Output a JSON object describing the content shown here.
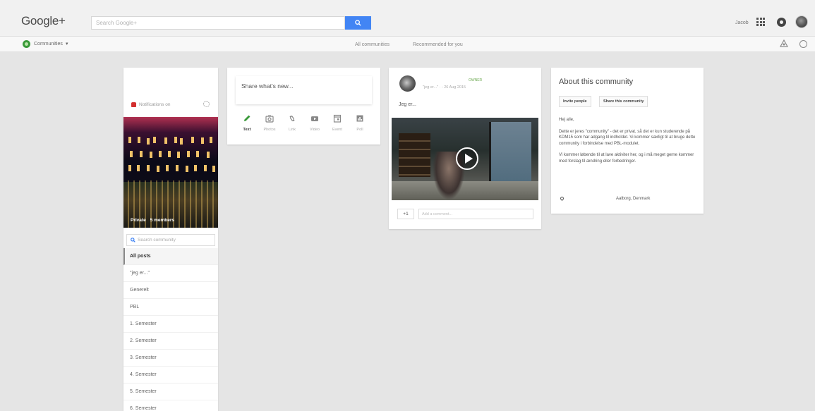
{
  "header": {
    "logo": "Google+",
    "search_placeholder": "Search Google+",
    "user_name": "Jacob"
  },
  "subnav": {
    "communities_label": "Communities",
    "all_communities": "All communities",
    "recommended": "Recommended for you"
  },
  "community": {
    "notifications": "Notifications on",
    "privacy": "Private",
    "members": "5 members",
    "search_placeholder": "Search community",
    "categories": [
      {
        "label": "All posts"
      },
      {
        "label": "\"jeg er...\""
      },
      {
        "label": "Generelt"
      },
      {
        "label": "PBL"
      },
      {
        "label": "1. Semester"
      },
      {
        "label": "2. Semester"
      },
      {
        "label": "3. Semester"
      },
      {
        "label": "4. Semester"
      },
      {
        "label": "5. Semester"
      },
      {
        "label": "6. Semester"
      }
    ]
  },
  "share": {
    "prompt": "Share what's new...",
    "options": [
      {
        "label": "Text",
        "icon": "pencil-icon"
      },
      {
        "label": "Photos",
        "icon": "camera-icon"
      },
      {
        "label": "Link",
        "icon": "link-icon"
      },
      {
        "label": "Video",
        "icon": "video-icon"
      },
      {
        "label": "Event",
        "icon": "event-icon"
      },
      {
        "label": "Poll",
        "icon": "poll-icon"
      }
    ]
  },
  "post": {
    "badge": "OWNER",
    "meta": "\"jeg er...\" · - 26 Aug 2015",
    "text": "Jeg er...",
    "plus_one": "+1",
    "comment_placeholder": "Add a comment..."
  },
  "about": {
    "title": "About this community",
    "invite_label": "Invite people",
    "share_label": "Share this community",
    "greeting": "Hej alle,",
    "para1": "Dette er jeres \"community\" - det er privat, så det er kun studerende på KDM15 som har adgang til indholdet. Vi kommer særligt til at bruge dette community i forbindelse med PBL-modulet.",
    "para2": "Vi kommer løbende til at lave aktiviter her, og i må meget gerne kommer med forslag til ændring eller forbedringer.",
    "location": "Aalborg, Denmark"
  },
  "colors": {
    "accent_blue": "#4285f4",
    "owner_green": "#6aa84f",
    "bell_red": "#d32f2f",
    "community_green": "#3a9a3a"
  }
}
